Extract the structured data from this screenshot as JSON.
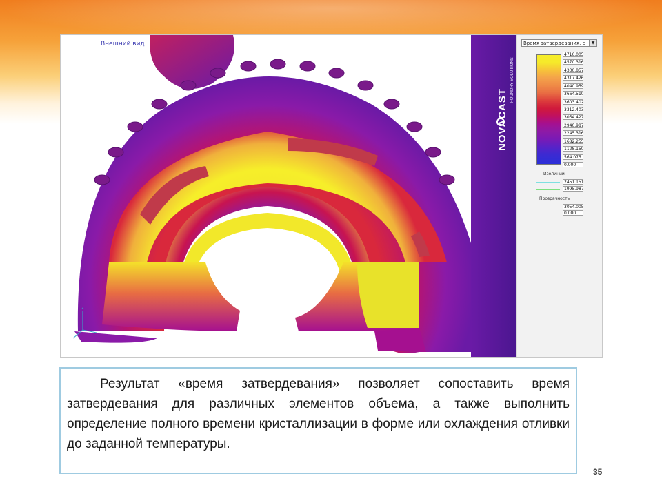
{
  "slide": {
    "page_number": "35"
  },
  "viewer": {
    "view_label": "Внешний вид",
    "brand": "NOVACAST",
    "brand_sub": "FOUNDRY SOLUTIONS"
  },
  "legend_panel": {
    "dropdown_value": "Время затвердевания, с",
    "colorbar_labels": [
      "4716.005",
      "4570.316",
      "4330.857",
      "4317.426",
      "4040.959",
      "3664.510",
      "3603.402",
      "3312.403",
      "3054.427",
      "2940.987",
      "2245.316",
      "1682.255",
      "1128.150",
      "564.075",
      "0.000"
    ],
    "isolines_title": "Изолинии",
    "isolines": [
      {
        "value": "2451.151",
        "color": "#7fe0e0"
      },
      {
        "value": "1995.987",
        "color": "#7fe07f"
      }
    ],
    "transparency_title": "Прозрачность",
    "transparency_values": [
      "3054.005",
      "0.000"
    ]
  },
  "caption": {
    "text": "Результат «время затвердевания» позволяет сопоставить время затвердевания для различных элементов объема, а также выполнить определение полного времени кристаллизации в форме или охлаждения отливки до заданной температуры."
  },
  "colors": {
    "hot": "#f6ee2a",
    "mid": "#d01a3c",
    "cold": "#6a1aa6",
    "caption_border": "#9fcbe1"
  }
}
